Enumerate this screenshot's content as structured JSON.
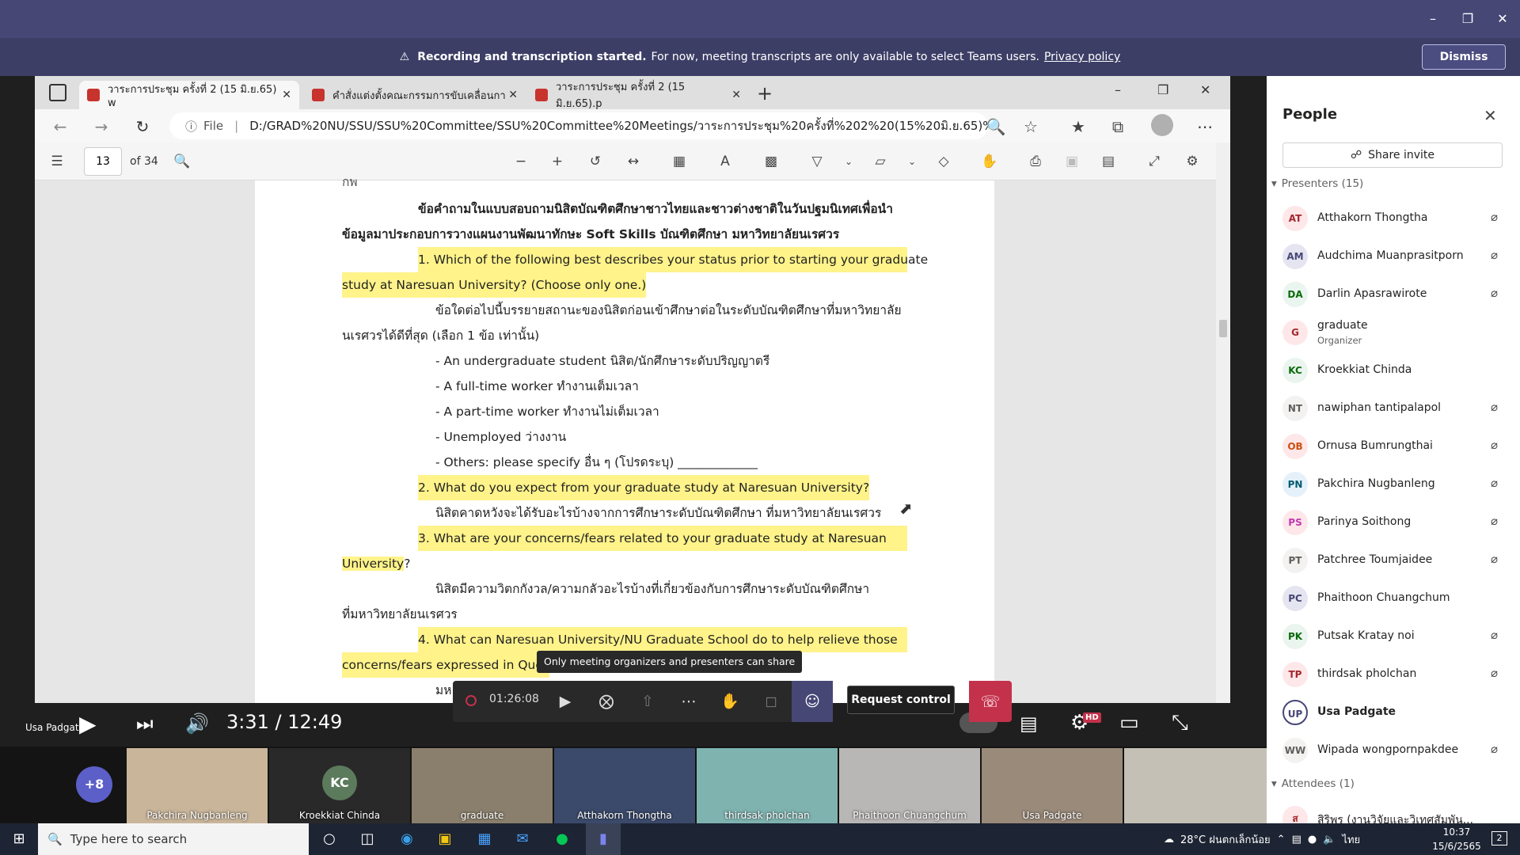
{
  "banner": {
    "title": "Recording and transcription started.",
    "message": "For now, meeting transcripts are only available to select Teams users.",
    "link": "Privacy policy",
    "dismiss": "Dismiss"
  },
  "browser": {
    "tabs": [
      {
        "label": "วาระการประชุม ครั้งที่ 2 (15 มิ.ย.65) w",
        "active": true
      },
      {
        "label": "คำสั่งแต่งตั้งคณะกรรมการขับเคลื่อนกา",
        "active": false
      },
      {
        "label": "วาระการประชุม ครั้งที่ 2 (15 มิ.ย.65).p",
        "active": false
      }
    ],
    "file_label": "File",
    "address": "D:/GRAD%20NU/SSU/SSU%20Committee/SSU%20Committee%20Meetings/วาระการประชุม%20ครั้งที่%202%20(15%20มิ.ย.65)%..."
  },
  "pdf": {
    "page": "13",
    "of": "of 34"
  },
  "doc": {
    "top_fragment": "กพ",
    "heading1": "ข้อคำถามในแบบสอบถามนิสิตบัณฑิตศึกษาชาวไทยและชาวต่างชาติในวันปฐมนิเทศเพื่อนำ",
    "heading2": "ข้อมูลมาประกอบการวางแผนงานพัฒนาทักษะ Soft Skills บัณฑิตศึกษา มหาวิทยาลัยนเรศวร",
    "q1a": "1.  Which of the following best describes your status prior to starting your graduate",
    "q1b": "study at Naresuan University? (Choose only one.)",
    "q1th_a": "ข้อใดต่อไปนี้บรรยายสถานะของนิสิตก่อนเข้าศึกษาต่อในระดับบัณฑิตศึกษาที่มหาวิทยาลัย",
    "q1th_b": "นเรศวรได้ดีที่สุด (เลือก 1 ข้อ เท่านั้น)",
    "opt1": "- An undergraduate student  นิสิต/นักศึกษาระดับปริญญาตรี",
    "opt2": "- A full-time worker  ทำงานเต็มเวลา",
    "opt3": "- A part-time worker  ทำงานไม่เต็มเวลา",
    "opt4": "- Unemployed  ว่างงาน",
    "opt5": "- Others: please specify อื่น ๆ (โปรดระบุ)  _____________",
    "q2": "2.  What do you expect from your graduate study at Naresuan University?",
    "q2th": "นิสิตคาดหวังจะได้รับอะไรบ้างจากการศึกษาระดับบัณฑิตศึกษา ที่มหาวิทยาลัยนเรศวร",
    "q3a": "3.  What  are  your  concerns/fears  related  to  your  graduate  study  at  Naresuan",
    "q3b": "University",
    "q3b_end": "?",
    "q3th_a": "นิสิตมีความวิตกกังวล/ความกลัวอะไรบ้างที่เกี่ยวข้องกับการศึกษาระดับบัณฑิตศึกษา",
    "q3th_b": "ที่มหาวิทยาลัยนเรศวร",
    "q4a": "4.  What  can  Naresuan  University/NU  Graduate  School  do  to  help  relieve  those",
    "q4b": "concerns/fears expressed in Ques",
    "bottom_fragment": "มห"
  },
  "player": {
    "presenter": "Usa Padgate",
    "time": "3:31 / 12:49",
    "hd": "HD"
  },
  "controls": {
    "timer": "01:26:08",
    "tooltip": "Only meeting organizers and presenters can share",
    "request_control": "Request control"
  },
  "strip": {
    "more": "+8",
    "tiles": [
      {
        "name": "Pakchira Nugbanleng"
      },
      {
        "name": "Kroekkiat Chinda",
        "initials": "KC"
      },
      {
        "name": "graduate"
      },
      {
        "name": "Atthakorn Thongtha"
      },
      {
        "name": "thirdsak pholchan"
      },
      {
        "name": "Phaithoon Chuangchum"
      },
      {
        "name": "Usa Padgate"
      },
      {
        "name": ""
      }
    ]
  },
  "people": {
    "title": "People",
    "share_invite": "Share invite",
    "presenters_header": "Presenters (15)",
    "attendees_header": "Attendees (1)",
    "presenters": [
      {
        "initials": "AT",
        "name": "Atthakorn Thongtha",
        "color": "#fde7e9",
        "fg": "#a4262c",
        "muted": true
      },
      {
        "initials": "AM",
        "name": "Audchima Muanprasitporn",
        "color": "#e5e5f1",
        "fg": "#464775",
        "muted": true
      },
      {
        "initials": "DA",
        "name": "Darlin Apasrawirote",
        "color": "#e9f5ee",
        "fg": "#0b6a0b",
        "muted": true
      },
      {
        "initials": "G",
        "name": "graduate",
        "role": "Organizer",
        "color": "#fde7e9",
        "fg": "#a4262c",
        "muted": false
      },
      {
        "initials": "KC",
        "name": "Kroekkiat Chinda",
        "color": "#e9f5ee",
        "fg": "#0b6a0b",
        "muted": false
      },
      {
        "initials": "NT",
        "name": "nawiphan tantipalapol",
        "color": "#f3f2f1",
        "fg": "#605e5c",
        "muted": true
      },
      {
        "initials": "OB",
        "name": "Ornusa Bumrungthai",
        "color": "#fde7e9",
        "fg": "#ca5010",
        "muted": true
      },
      {
        "initials": "PN",
        "name": "Pakchira Nugbanleng",
        "color": "#e5f1fa",
        "fg": "#005b70",
        "muted": true
      },
      {
        "initials": "PS",
        "name": "Parinya Soithong",
        "color": "#fde7e9",
        "fg": "#c239b3",
        "muted": true
      },
      {
        "initials": "PT",
        "name": "Patchree Toumjaidee",
        "color": "#f3f2f1",
        "fg": "#605e5c",
        "muted": true
      },
      {
        "initials": "PC",
        "name": "Phaithoon Chuangchum",
        "color": "#e5e5f1",
        "fg": "#464775",
        "muted": false
      },
      {
        "initials": "PK",
        "name": "Putsak Kratay noi",
        "color": "#e9f5ee",
        "fg": "#0b6a0b",
        "muted": true
      },
      {
        "initials": "TP",
        "name": "thirdsak pholchan",
        "color": "#fde7e9",
        "fg": "#a4262c",
        "muted": true
      },
      {
        "initials": "UP",
        "name": "Usa Padgate",
        "color": "#ffffff",
        "fg": "#464775",
        "muted": false
      },
      {
        "initials": "WW",
        "name": "Wipada wongpornpakdee",
        "color": "#f3f2f1",
        "fg": "#605e5c",
        "muted": true
      }
    ],
    "attendee": {
      "initials": "ส",
      "name": "สิริพร (งานวิจัยและวิเทศสัมพัน..."
    }
  },
  "taskbar": {
    "search_placeholder": "Type here to search",
    "weather": "28°C  ฝนตกเล็กน้อย",
    "lang": "ไทย",
    "time": "10:37",
    "date": "15/6/2565",
    "notif": "2"
  }
}
